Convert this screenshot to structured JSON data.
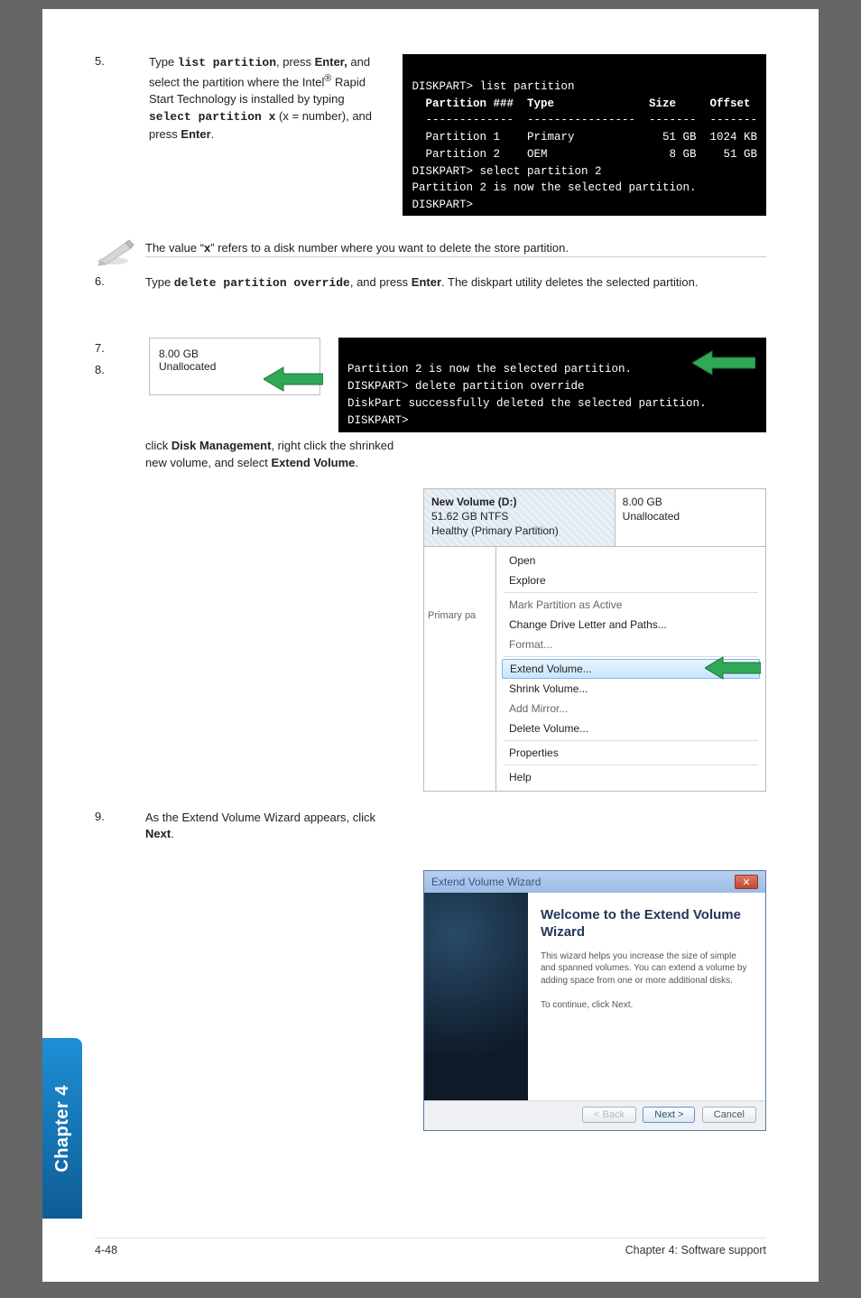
{
  "step5": {
    "num": "5.",
    "text_parts": {
      "p1": "Type ",
      "cmd1": "list partition",
      "p2": ", press ",
      "b1": "Enter,",
      "p3": " and select the partition where the Intel",
      "reg": "®",
      "p4": " Rapid Start Technology is installed by typing ",
      "cmd2": "select partition x",
      "p5": " (x = number), and press ",
      "b2": "Enter",
      "p6": "."
    }
  },
  "term1": {
    "l1": "DISKPART> list partition",
    "h1": "  Partition ###  Type              Size     Offset",
    "h2": "  -------------  ----------------  -------  -------",
    "r1": "  Partition 1    Primary             51 GB  1024 KB",
    "r2": "  Partition 2    OEM                  8 GB    51 GB",
    "l2": "DISKPART> select partition 2",
    "l3": "Partition 2 is now the selected partition.",
    "l4": "DISKPART>"
  },
  "note": "The value “x” refers to a disk number where you want to delete the store partition.",
  "step6": {
    "num": "6.",
    "p1": "Type ",
    "cmd": "delete partition override",
    "p2": ", and press ",
    "b1": "Enter",
    "p3": ". The diskpart utility deletes the selected partition."
  },
  "step7": {
    "num": "7."
  },
  "step8": {
    "num": "8.",
    "p1": "click ",
    "b1": "Disk Management",
    "p2": ", right click the shrinked new volume, and select ",
    "b2": "Extend Volume",
    "p3": "."
  },
  "dm": {
    "size": "8.00 GB",
    "status": "Unallocated"
  },
  "term2": {
    "l1": "Partition 2 is now the selected partition.",
    "l2": "DISKPART> delete partition override",
    "l3": "DiskPart successfully deleted the selected partition.",
    "l4": "DISKPART>"
  },
  "ctx": {
    "hdr_left_l1": "New Volume  (D:)",
    "hdr_left_l2": "51.62 GB NTFS",
    "hdr_left_l3": "Healthy (Primary Partition)",
    "hdr_right_l1": "8.00 GB",
    "hdr_right_l2": "Unallocated",
    "left_label": "Primary pa",
    "items": {
      "open": "Open",
      "explore": "Explore",
      "mark": "Mark Partition as Active",
      "change": "Change Drive Letter and Paths...",
      "format": "Format...",
      "extend": "Extend Volume...",
      "shrink": "Shrink Volume...",
      "mirror": "Add Mirror...",
      "delete": "Delete Volume...",
      "props": "Properties",
      "help": "Help"
    }
  },
  "step9": {
    "num": "9.",
    "p1": "As the Extend Volume Wizard appears, click ",
    "b1": "Next",
    "p2": "."
  },
  "wizard": {
    "title": "Extend Volume Wizard",
    "heading": "Welcome to the Extend Volume Wizard",
    "para": "This wizard helps you increase the size of simple and spanned volumes. You can extend a volume by adding space from one or more additional disks.",
    "cont": "To continue, click Next.",
    "back": "< Back",
    "next": "Next >",
    "cancel": "Cancel"
  },
  "side_tab": "Chapter 4",
  "footer": {
    "left": "4-48",
    "right": "Chapter 4: Software support"
  }
}
